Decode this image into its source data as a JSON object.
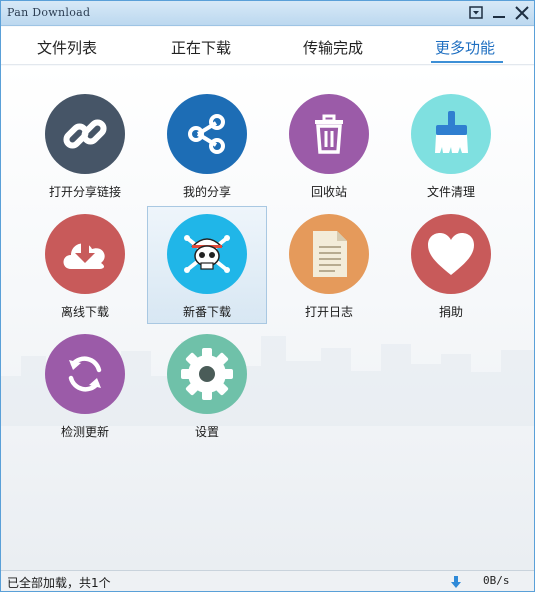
{
  "window": {
    "title": "Pan Download"
  },
  "tabs": [
    {
      "label": "文件列表"
    },
    {
      "label": "正在下载"
    },
    {
      "label": "传输完成"
    },
    {
      "label": "更多功能"
    }
  ],
  "active_tab": "更多功能",
  "grid": {
    "items": [
      {
        "label": "打开分享链接",
        "icon": "link-icon",
        "color": "#465567"
      },
      {
        "label": "我的分享",
        "icon": "share-icon",
        "color": "#1d6db5"
      },
      {
        "label": "回收站",
        "icon": "trash-icon",
        "color": "#9b5ba8"
      },
      {
        "label": "文件清理",
        "icon": "broom-icon",
        "color": "#7fe0e0"
      },
      {
        "label": "离线下载",
        "icon": "cloud-download-icon",
        "color": "#c85a5a"
      },
      {
        "label": "新番下载",
        "icon": "skull-icon",
        "color": "#20b6e8"
      },
      {
        "label": "打开日志",
        "icon": "document-icon",
        "color": "#e59a5b"
      },
      {
        "label": "捐助",
        "icon": "heart-icon",
        "color": "#c85a5a"
      },
      {
        "label": "检测更新",
        "icon": "refresh-icon",
        "color": "#9b5ba8"
      },
      {
        "label": "设置",
        "icon": "gear-icon",
        "color": "#6fc1a9"
      }
    ],
    "selected": "新番下载"
  },
  "status": {
    "text": "已全部加载，共1个",
    "speed": "0B/s"
  }
}
